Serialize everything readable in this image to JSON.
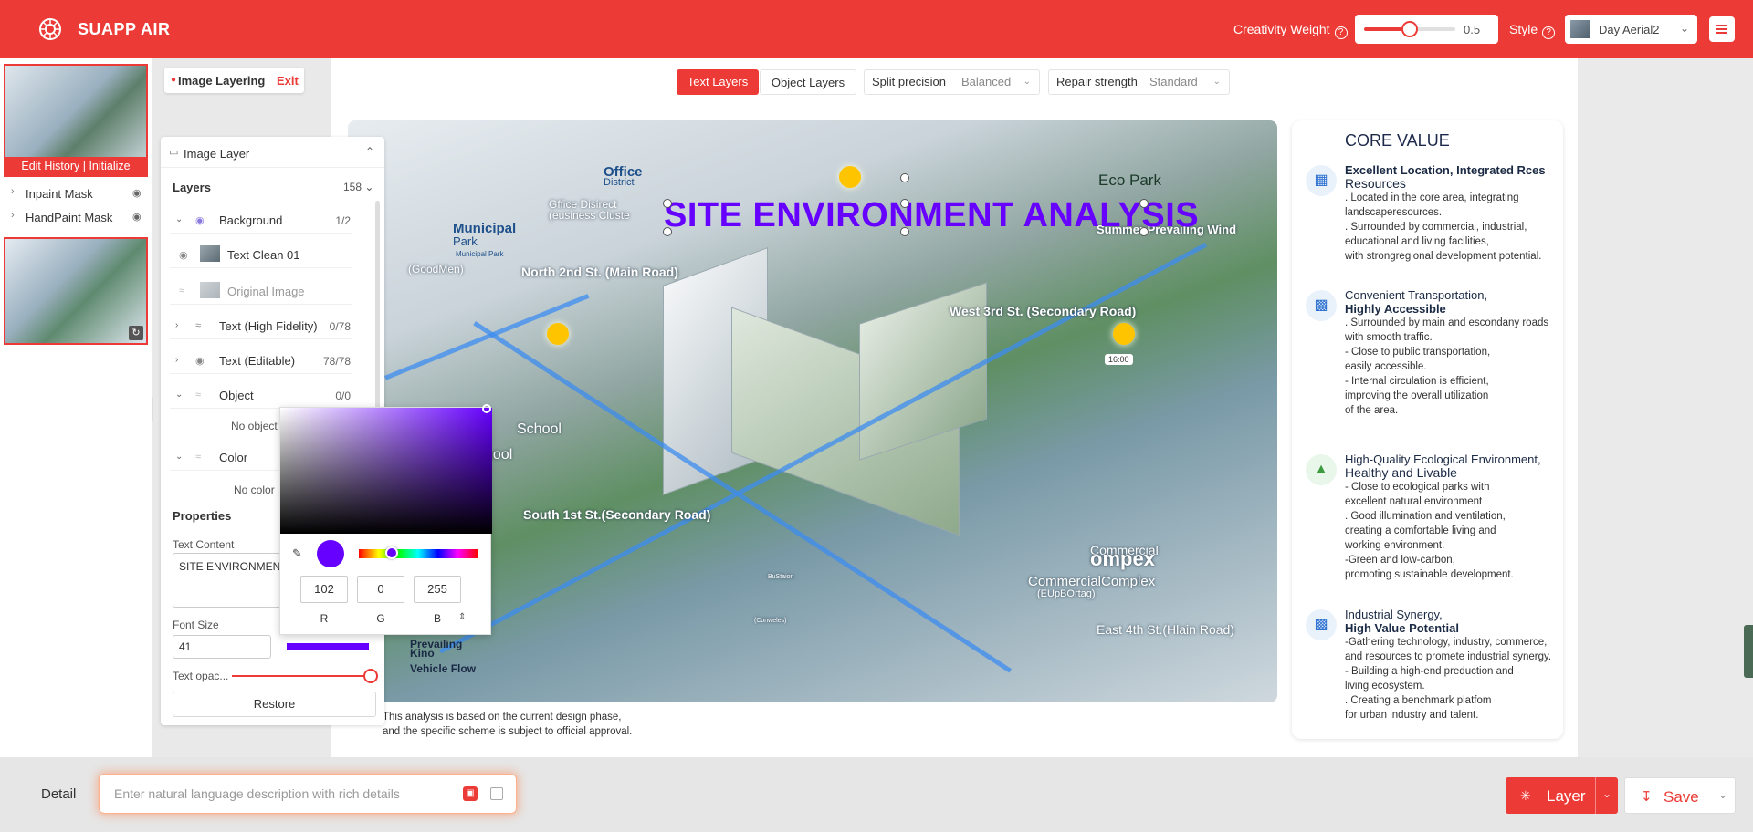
{
  "app": {
    "brand": "SUAPP AIR"
  },
  "topbar": {
    "creativity_label": "Creativity Weight",
    "creativity_value": "0.5",
    "creativity_fraction": 0.5,
    "style_label": "Style",
    "style_value": "Day Aerial2"
  },
  "history": {
    "edit_label": "Edit History | Initialize",
    "masks": [
      {
        "label": "Inpaint Mask"
      },
      {
        "label": "HandPaint Mask"
      }
    ]
  },
  "mode": {
    "label": "Image Layering",
    "exit": "Exit"
  },
  "toolbar": {
    "text_layers": "Text Layers",
    "object_layers": "Object Layers",
    "split_label": "Split precision",
    "split_value": "Balanced",
    "repair_label": "Repair strength",
    "repair_value": "Standard"
  },
  "layer_panel": {
    "title": "Image Layer",
    "layers_label": "Layers",
    "layers_count": "158",
    "rows": [
      {
        "name": "Background",
        "count": "1/2"
      },
      {
        "name": "Text Clean 01",
        "count": ""
      },
      {
        "name": "Original Image",
        "count": ""
      },
      {
        "name": "Text (High Fidelity)",
        "count": "0/78"
      },
      {
        "name": "Text (Editable)",
        "count": "78/78"
      },
      {
        "name": "Object",
        "count": "0/0"
      },
      {
        "name": "Color",
        "count": ""
      }
    ],
    "no_object": "No object",
    "no_color": "No color",
    "properties_label": "Properties",
    "text_content_label": "Text Content",
    "text_content_value": "SITE ENVIRONMENT ANALYSIS",
    "font_size_label": "Font Size",
    "font_size_value": "41",
    "text_color": "#6600ff",
    "opacity_label": "Text opac...",
    "opacity_fraction": 1.0,
    "restore": "Restore"
  },
  "color_picker": {
    "r": "102",
    "g": "0",
    "b": "255",
    "r_label": "R",
    "g_label": "G",
    "b_label": "B",
    "hex": "#6600ff"
  },
  "canvas": {
    "title": "SITE ENVIRONMENT ANALYSIS",
    "labels": {
      "office": "Office",
      "district": "District",
      "office_district": "Gffice Disirect",
      "office_sub": "(eusiness Cluste",
      "municipal": "Municipal",
      "park": "Park",
      "municipal_park": "Municipal Park",
      "goodmen": "(GoodMen)",
      "eco_park": "Eco Park",
      "wind": "Summer Prevailing Wind",
      "north_road": "North 2nd St. (Main Road)",
      "west_road": "West 3rd St. (Secondary Road)",
      "south_road": "South 1st St.(Secondary Road)",
      "east_road": "East 4th St.(Hlain Road)",
      "school": "School",
      "school2": "hool",
      "time": "16:00",
      "commercial": "Commercial",
      "complex": "ompex",
      "commercial_complex": "CommercialComplex",
      "commercial_sub": "(EUpBOrtag)",
      "bus": "BuStaion",
      "bus_sub": "(Conweles)",
      "prevailing": "Prevailing",
      "kino": "Kino",
      "vehicle_flow": "Vehicle Flow"
    },
    "disclaimer_1": "This analysis is based on the current design phase,",
    "disclaimer_2": "and the specific scheme is subject to official approval."
  },
  "core_value": {
    "title": "CORE VALUE",
    "sections": [
      {
        "h1": "Excellent Location, Integrated Rces",
        "h2": "Resources",
        "lines": [
          ". Located in the core area, integrating",
          "  landscaperesources.",
          ". Surrounded by commercial, industrial,",
          "  educational and living facilities,",
          "  with strongregional development potential."
        ]
      },
      {
        "h1": "Convenient Transportation,",
        "h2": "Highly Accessible",
        "lines": [
          ". Surrounded by main and escondany roads",
          "  with smooth traffic.",
          "- Close to public transportation,",
          "  easily accessible.",
          "- Internal circulation is efficient,",
          "  improving the overall utilization",
          "  of the area."
        ]
      },
      {
        "h1": "High-Quality Ecological Environment,",
        "h2": "Healthy and Livable",
        "lines": [
          "- Close to ecological parks with",
          "  excellent natural environment",
          ". Good illumination and ventilation,",
          "  creating a comfortable living and",
          "  working environment.",
          "-Green and low-carbon,",
          "  promoting sustainable development."
        ]
      },
      {
        "h1": "Industrial Synergy,",
        "h2": "High Value Potential",
        "lines": [
          "-Gathering technology, industry, commerce,",
          "  and resources to promete industrial synergy.",
          "- Building a high-end preduction and",
          "  living ecosystem.",
          ". Creating a benchmark platfom",
          "  for urban industry and talent."
        ]
      }
    ]
  },
  "bottom": {
    "detail_label": "Detail",
    "prompt_placeholder": "Enter natural language description with rich details",
    "layer_button": "Layer",
    "save_button": "Save"
  },
  "colors": {
    "accent": "#ec3b36",
    "text_color": "#6600ff"
  },
  "icons": [
    "logo-icon",
    "question-icon",
    "menu-icon",
    "eye-icon",
    "chevron-icon",
    "refresh-icon",
    "eyedropper-icon",
    "layer-icon",
    "download-icon"
  ]
}
